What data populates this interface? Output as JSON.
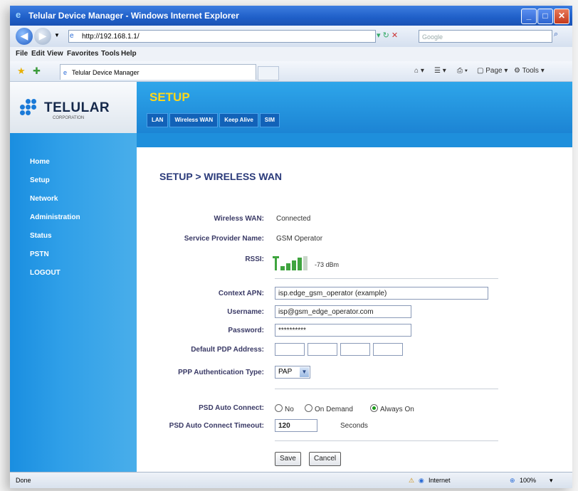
{
  "window": {
    "title": "Telular Device Manager - Windows Internet Explorer"
  },
  "address_bar": {
    "url": "http://192.168.1.1/",
    "search_placeholder": "Google"
  },
  "menu": [
    "File",
    "Edit",
    "View",
    "Favorites",
    "Tools",
    "Help"
  ],
  "browser_tab": {
    "label": "Telular Device Manager"
  },
  "command_bar": {
    "page": "Page",
    "tools": "Tools"
  },
  "brand": {
    "name": "TELULAR",
    "tagline": "CORPORATION"
  },
  "header": {
    "title": "SETUP",
    "tabs": [
      "LAN",
      "Wireless WAN",
      "Keep Alive",
      "SIM"
    ]
  },
  "sidebar": {
    "items": [
      "Home",
      "Setup",
      "Network",
      "Administration",
      "Status",
      "PSTN",
      "LOGOUT"
    ]
  },
  "page": {
    "heading": "SETUP > WIRELESS WAN"
  },
  "status_info": {
    "wwan_label": "Wireless WAN:",
    "wwan_value": "Connected",
    "provider_label": "Service Provider Name:",
    "provider_value": "GSM Operator",
    "rssi_label": "RSSI:",
    "rssi_value": "-73 dBm",
    "rssi_bars_filled": 4,
    "rssi_bars_total": 5
  },
  "form": {
    "apn_label": "Context APN:",
    "apn_value": "isp.edge_gsm_operator (example)",
    "username_label": "Username:",
    "username_value": "isp@gsm_edge_operator.com",
    "password_label": "Password:",
    "password_value": "**********",
    "pdp_label": "Default PDP Address:",
    "auth_label": "PPP Authentication Type:",
    "auth_value": "PAP",
    "psd_label": "PSD Auto Connect:",
    "psd_options": [
      "No",
      "On Demand",
      "Always On"
    ],
    "psd_selected": "Always On",
    "timeout_label": "PSD Auto Connect Timeout:",
    "timeout_value": "120",
    "timeout_unit": "Seconds"
  },
  "buttons": {
    "save": "Save",
    "cancel": "Cancel"
  },
  "statusbar": {
    "left": "Done",
    "zone": "Internet",
    "zoom": "100%"
  },
  "colors": {
    "header_blue": "#1c84d4",
    "setup_yellow": "#ffd81a",
    "heading_navy": "#2a3a7a"
  }
}
